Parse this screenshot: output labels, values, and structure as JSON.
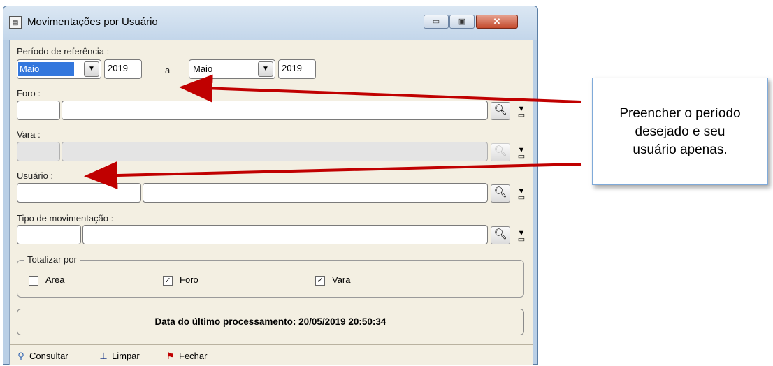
{
  "window": {
    "title": "Movimentações por Usuário",
    "icon_name": "app-icon",
    "controls": {
      "minimize": "▭",
      "maximize": "▣",
      "close": "✕"
    }
  },
  "periodo": {
    "label": "Período de referência :",
    "start_month": "Maio",
    "start_year": "2019",
    "separator": "a",
    "end_month": "Maio",
    "end_year": "2019"
  },
  "foro": {
    "label": "Foro :",
    "code": "",
    "name": ""
  },
  "vara": {
    "label": "Vara :",
    "code": "",
    "name": ""
  },
  "usuario": {
    "label": "Usuário :",
    "code": "",
    "name": ""
  },
  "tipo": {
    "label": "Tipo de movimentação :",
    "code": "",
    "name": ""
  },
  "totalizar": {
    "legend": "Totalizar por",
    "options": [
      {
        "label": "Area",
        "checked": false
      },
      {
        "label": "Foro",
        "checked": true
      },
      {
        "label": "Vara",
        "checked": true
      }
    ]
  },
  "info": {
    "text": "Data do último processamento: 20/05/2019 20:50:34"
  },
  "toolbar": {
    "consultar": "Consultar",
    "limpar": "Limpar",
    "fechar": "Fechar"
  },
  "callout": {
    "lines": [
      "Preencher o período",
      "desejado e seu",
      "usuário apenas."
    ]
  },
  "colors": {
    "arrow": "#c00000",
    "callout_border": "#7faad9",
    "client_bg": "#f3efe2"
  }
}
